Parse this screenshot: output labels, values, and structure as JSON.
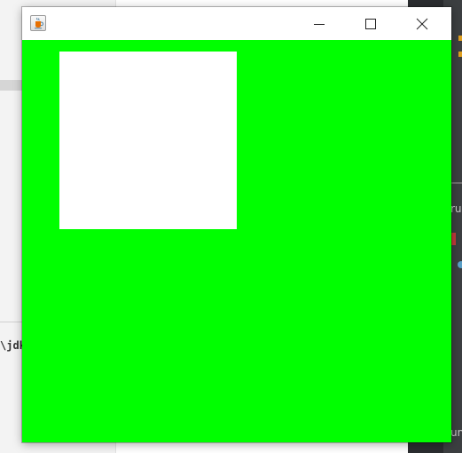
{
  "background": {
    "left_partial_text": "\\jdk",
    "right_partial_texts": [
      "ru",
      "un"
    ]
  },
  "window": {
    "title": "",
    "app_icon": "java-cup-icon",
    "buttons": {
      "minimize_icon": "minimize-icon",
      "maximize_icon": "maximize-icon",
      "close_icon": "close-icon"
    },
    "client_color": "#00ff00",
    "shape_color": "#ffffff"
  }
}
